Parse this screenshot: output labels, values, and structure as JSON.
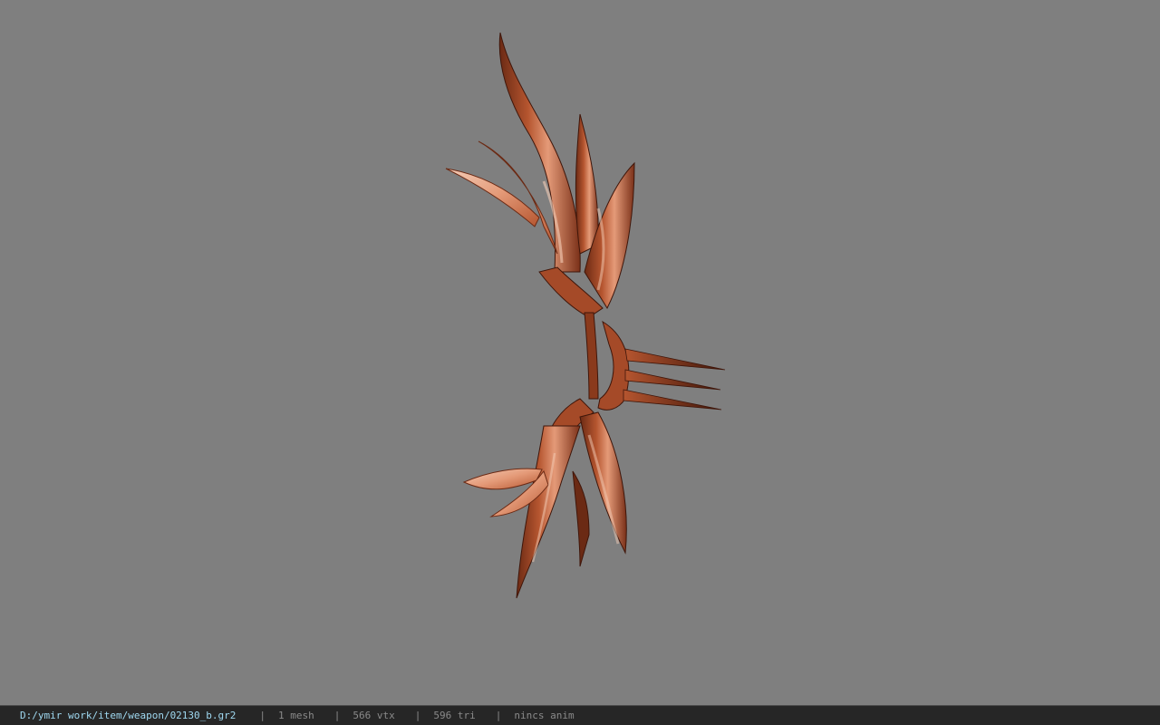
{
  "window": {
    "background_color": "#7f7f7f"
  },
  "model": {
    "icon": "weapon-model-icon",
    "colors": {
      "dark": "#6b2a14",
      "mid": "#b5552f",
      "light": "#e49a78",
      "highlight": "#f4cdb8",
      "edge": "#3f160a"
    }
  },
  "status_bar": {
    "file_path": "D:/ymir work/item/weapon/02130_b.gr2",
    "separator": "|",
    "mesh_count": "1 mesh",
    "vertex_count": "566 vtx",
    "triangle_count": "596 tri",
    "animation": "nincs anim",
    "text_color": "#8a8a8a",
    "path_color": "#9fd8f0"
  }
}
